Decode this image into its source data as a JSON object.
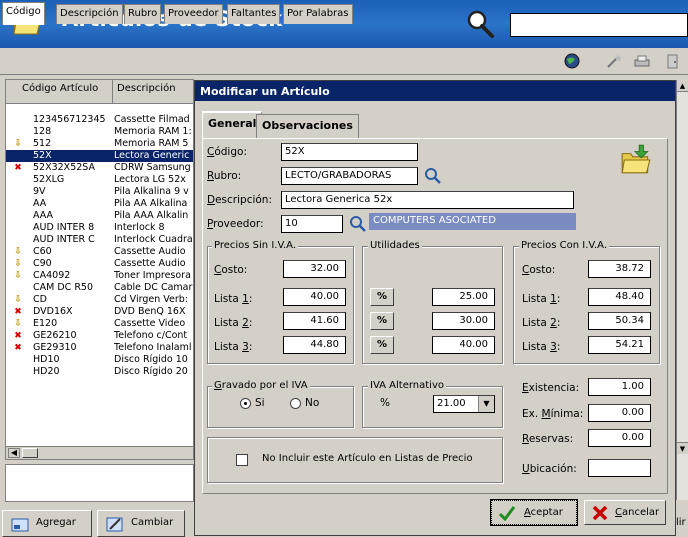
{
  "header": {
    "title": "Artículos de Stock",
    "search_value": ""
  },
  "search_tabs": [
    "Código",
    "Descripción",
    "Rubro",
    "Proveedor",
    "Faltantes",
    "Por Palabras"
  ],
  "grid": {
    "columns": [
      "Código Artículo",
      "Descripción"
    ],
    "rows": [
      {
        "marker": "",
        "code": "123456712345",
        "desc": "Cassette Filmad"
      },
      {
        "marker": "",
        "code": "128",
        "desc": "Memoria RAM 1:"
      },
      {
        "marker": "arrow",
        "code": "512",
        "desc": "Memoria RAM 5"
      },
      {
        "marker": "",
        "code": "52X",
        "desc": "Lectora Generic",
        "selected": true
      },
      {
        "marker": "x",
        "code": "52X32X52SA",
        "desc": "CDRW Samsung"
      },
      {
        "marker": "",
        "code": "52XLG",
        "desc": "Lectora LG 52x"
      },
      {
        "marker": "",
        "code": "9V",
        "desc": "Pila Alkalina 9 v"
      },
      {
        "marker": "",
        "code": "AA",
        "desc": "Pila AA Alkalina"
      },
      {
        "marker": "",
        "code": "AAA",
        "desc": "Pila AAA Alkalin"
      },
      {
        "marker": "",
        "code": "AUD INTER 8",
        "desc": "Interlock 8"
      },
      {
        "marker": "",
        "code": "AUD INTER C",
        "desc": "Interlock Cuadra"
      },
      {
        "marker": "arrow",
        "code": "C60",
        "desc": "Cassette Audio"
      },
      {
        "marker": "arrow",
        "code": "C90",
        "desc": "Cassette Audio"
      },
      {
        "marker": "arrow",
        "code": "CA4092",
        "desc": "Toner Impresora"
      },
      {
        "marker": "",
        "code": "CAM DC R50",
        "desc": "Cable DC Camar"
      },
      {
        "marker": "arrow",
        "code": "CD",
        "desc": "Cd Virgen Verb:"
      },
      {
        "marker": "x",
        "code": "DVD16X",
        "desc": "DVD BenQ 16X"
      },
      {
        "marker": "arrow",
        "code": "E120",
        "desc": "Cassette Video"
      },
      {
        "marker": "x",
        "code": "GE26210",
        "desc": "Telefono c/Cont"
      },
      {
        "marker": "x",
        "code": "GE29310",
        "desc": "Telefono Inalaml"
      },
      {
        "marker": "",
        "code": "HD10",
        "desc": "Disco Rígido 10"
      },
      {
        "marker": "",
        "code": "HD20",
        "desc": "Disco Rígido 20"
      }
    ]
  },
  "bottom_buttons": {
    "agregar": "Agregar",
    "cambiar": "Cambiar",
    "salir_fragment": "lir"
  },
  "dialog": {
    "title": "Modificar un Artículo",
    "tabs": [
      "General",
      "Observaciones"
    ],
    "codigo_label": "Código:",
    "codigo_value": "52X",
    "rubro_label": "Rubro:",
    "rubro_value": "LECTO/GRABADORAS",
    "descripcion_label": "Descripción:",
    "descripcion_value": "Lectora Generica 52x",
    "proveedor_label": "Proveedor:",
    "proveedor_value": "10",
    "proveedor_name": "COMPUTERS ASOCIATED",
    "precios_sin_iva": {
      "title": "Precios Sin I.V.A.",
      "costo_label": "Costo:",
      "costo": "32.00",
      "lista1_label": "Lista 1:",
      "lista1": "40.00",
      "lista2_label": "Lista 2:",
      "lista2": "41.60",
      "lista3_label": "Lista 3:",
      "lista3": "44.80"
    },
    "utilidades": {
      "title": "Utilidades",
      "pct_label": "%",
      "u1": "25.00",
      "u2": "30.00",
      "u3": "40.00"
    },
    "precios_con_iva": {
      "title": "Precios Con I.V.A.",
      "costo_label": "Costo:",
      "costo": "38.72",
      "lista1_label": "Lista 1:",
      "lista1": "48.40",
      "lista2_label": "Lista 2:",
      "lista2": "50.34",
      "lista3_label": "Lista 3:",
      "lista3": "54.21"
    },
    "gravado": {
      "title": "Gravado por el IVA",
      "si": "Si",
      "no": "No",
      "selected": "Si"
    },
    "iva_alternativo": {
      "title": "IVA Alternativo",
      "pct_label": "%",
      "value": "21.00"
    },
    "no_incluir_label": "No Incluir este Artículo en Listas de Precio",
    "existencia_label": "Existencia:",
    "existencia": "1.00",
    "ex_minima_label": "Ex. Mínima:",
    "ex_minima": "0.00",
    "reservas_label": "Reservas:",
    "reservas": "0.00",
    "ubicacion_label": "Ubicación:",
    "ubicacion": "",
    "aceptar": "Aceptar",
    "cancelar": "Cancelar"
  },
  "colors": {
    "header_blue": "#2b74c9",
    "title_bar": "#0a246a",
    "selection": "#0a246a",
    "proveedor_highlight": "#7b8cc2",
    "arrow_marker": "#b89000",
    "x_marker": "#d00000"
  }
}
